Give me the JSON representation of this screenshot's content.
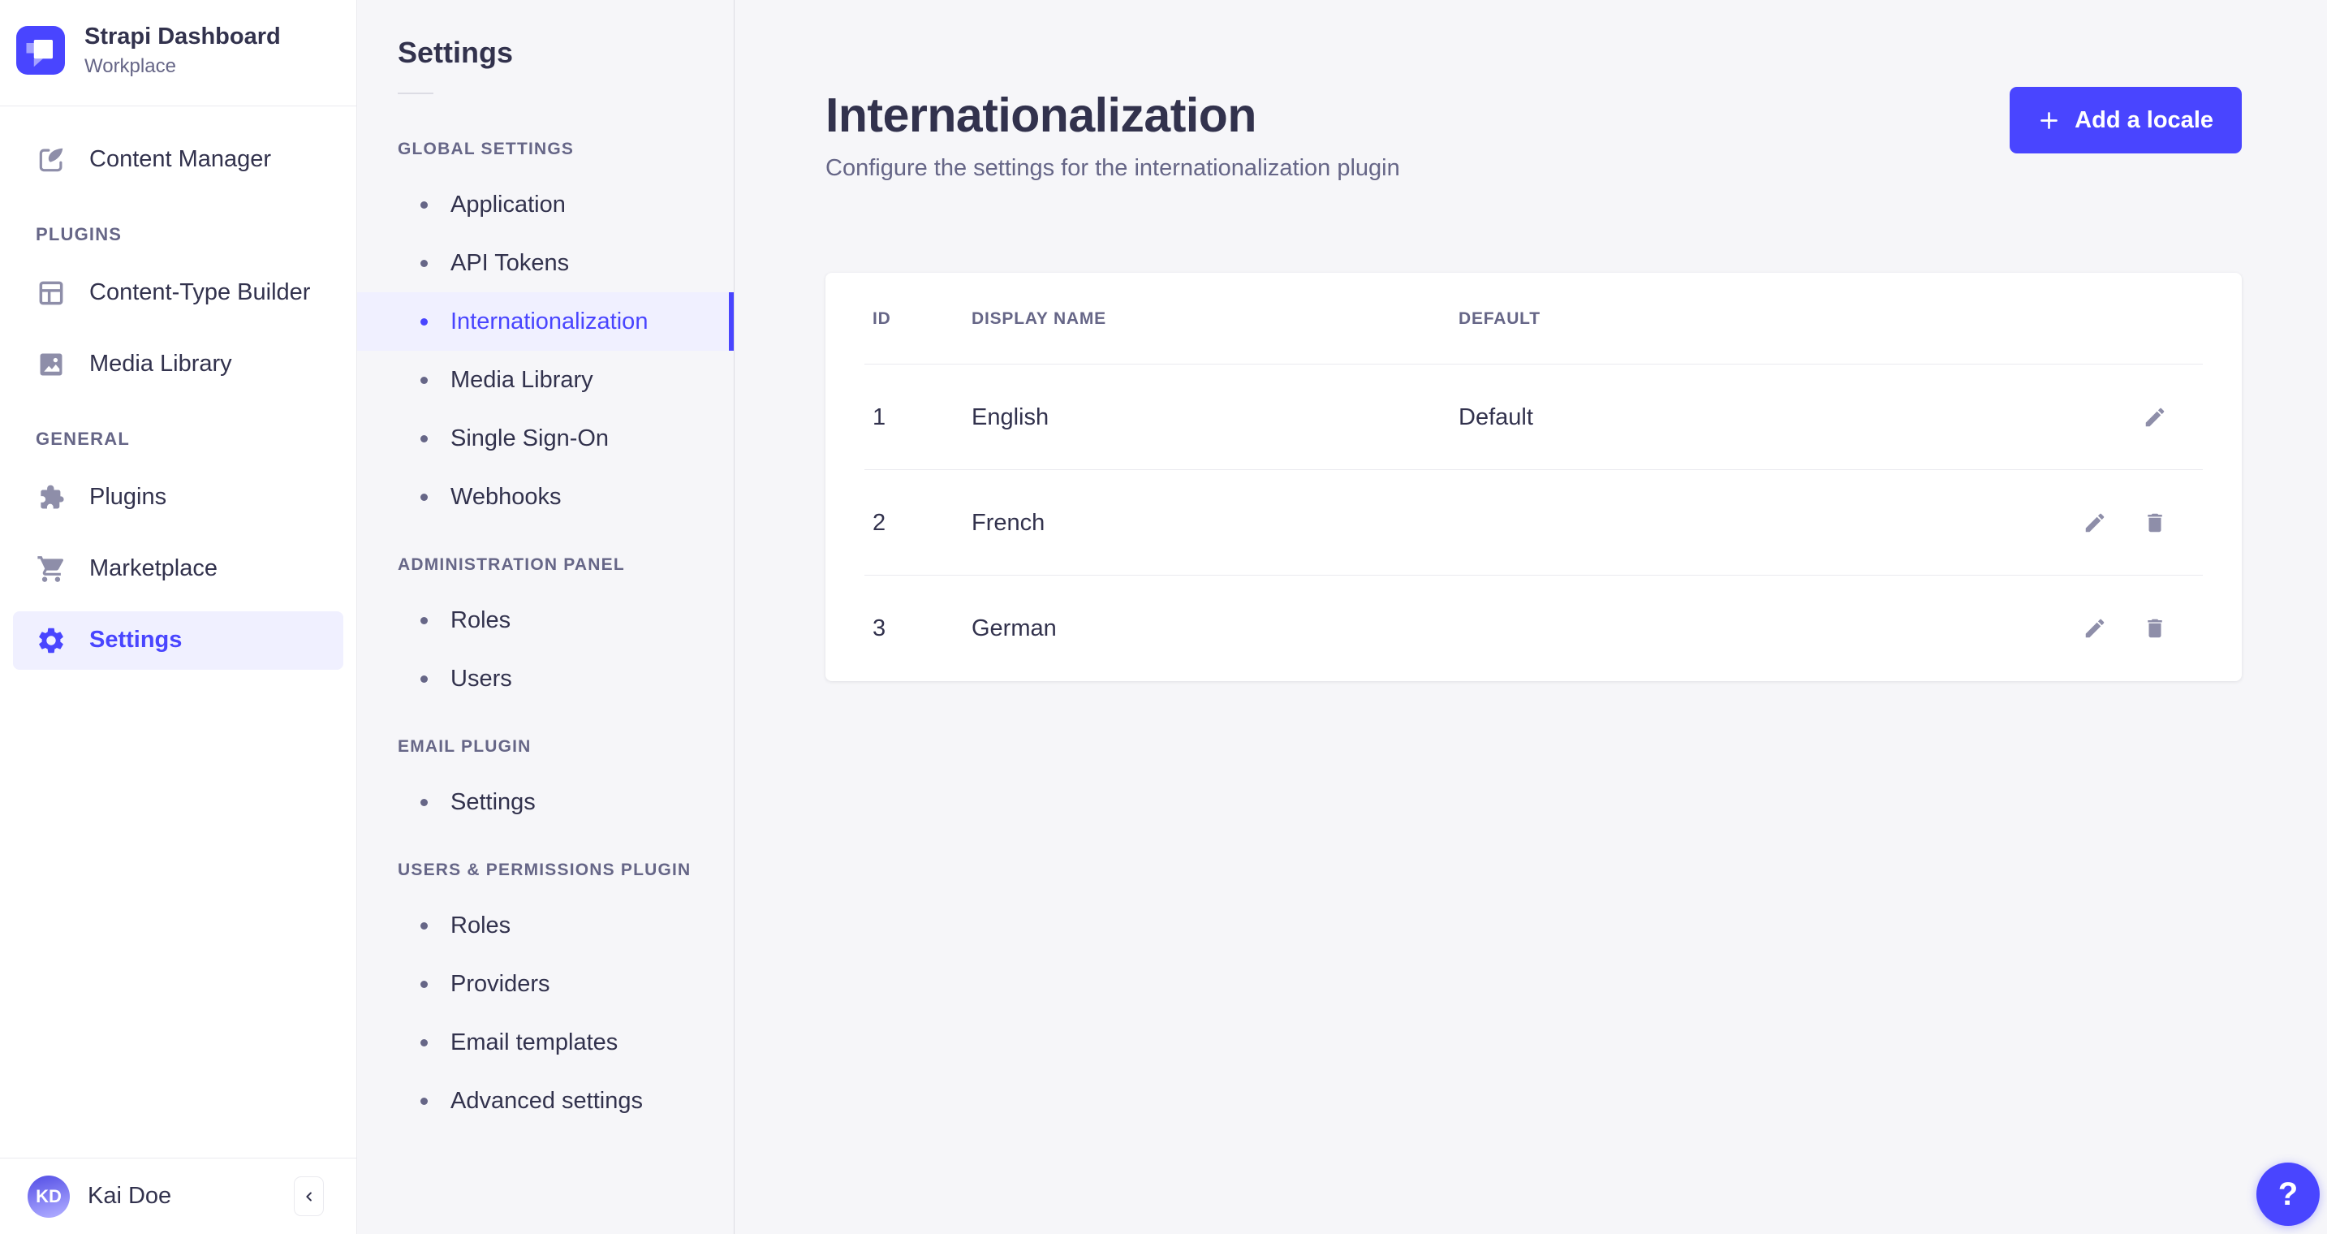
{
  "brand": {
    "title": "Strapi Dashboard",
    "subtitle": "Workplace"
  },
  "main_nav": {
    "content_manager": "Content Manager",
    "sections": [
      {
        "label": "PLUGINS",
        "items": [
          "Content-Type Builder",
          "Media Library"
        ]
      },
      {
        "label": "GENERAL",
        "items": [
          "Plugins",
          "Marketplace",
          "Settings"
        ]
      }
    ],
    "active_item": "Settings"
  },
  "user": {
    "initials": "KD",
    "name": "Kai Doe"
  },
  "settings_nav": {
    "title": "Settings",
    "sections": [
      {
        "label": "GLOBAL SETTINGS",
        "items": [
          "Application",
          "API Tokens",
          "Internationalization",
          "Media Library",
          "Single Sign-On",
          "Webhooks"
        ]
      },
      {
        "label": "ADMINISTRATION PANEL",
        "items": [
          "Roles",
          "Users"
        ]
      },
      {
        "label": "EMAIL PLUGIN",
        "items": [
          "Settings"
        ]
      },
      {
        "label": "USERS & PERMISSIONS PLUGIN",
        "items": [
          "Roles",
          "Providers",
          "Email templates",
          "Advanced settings"
        ]
      }
    ],
    "active_item": "Internationalization"
  },
  "page": {
    "title": "Internationalization",
    "subtitle": "Configure the settings for the internationalization plugin",
    "add_button": "Add a locale"
  },
  "table": {
    "columns": [
      "ID",
      "DISPLAY NAME",
      "DEFAULT"
    ],
    "rows": [
      {
        "id": "1",
        "display_name": "English",
        "default": "Default"
      },
      {
        "id": "2",
        "display_name": "French",
        "default": ""
      },
      {
        "id": "3",
        "display_name": "German",
        "default": ""
      }
    ]
  },
  "help": {
    "label": "?"
  },
  "icons": {
    "logo": "strapi-logo",
    "nav": [
      "content-manager-icon",
      "content-type-builder-icon",
      "media-library-icon",
      "plugins-icon",
      "marketplace-icon",
      "settings-gear-icon"
    ],
    "row_actions": [
      "edit-pencil-icon",
      "delete-trash-icon"
    ],
    "other": [
      "plus-icon",
      "chevron-left-icon",
      "question-mark-icon"
    ]
  },
  "colors": {
    "primary": "#4945FF",
    "active_bg": "#F0F0FF",
    "text": "#32324D",
    "muted": "#666687",
    "icon_gray": "#8E8EA9",
    "border": "#EAEAEF",
    "page_bg": "#F6F6F9",
    "card_bg": "#FFFFFF"
  }
}
